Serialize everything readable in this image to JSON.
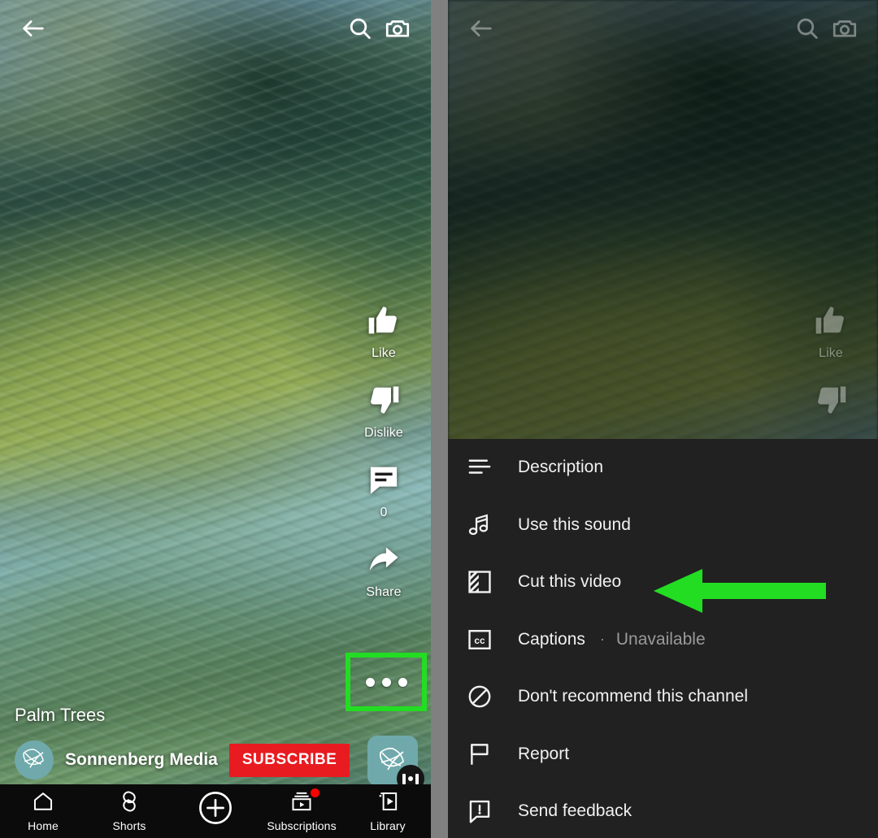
{
  "colors": {
    "accent_green": "#22dd22",
    "subscribe_red": "#e81b21",
    "sheet_bg": "#212121",
    "nav_bg": "#0b0b0b",
    "avatar_teal": "#6fa9ab",
    "divider_gray": "#808080"
  },
  "topbar": {
    "back_icon": "back-arrow-icon",
    "search_icon": "search-icon",
    "camera_icon": "camera-icon"
  },
  "shorts_player": {
    "video_title": "Palm Trees",
    "channel_name": "Sonnenberg Media",
    "subscribe_label": "SUBSCRIBE",
    "sound_disc_label": "sound-disc",
    "actions": [
      {
        "id": "like",
        "icon": "thumbs-up-icon",
        "label": "Like"
      },
      {
        "id": "dislike",
        "icon": "thumbs-down-icon",
        "label": "Dislike"
      },
      {
        "id": "comment",
        "icon": "comment-icon",
        "label": "0"
      },
      {
        "id": "share",
        "icon": "share-arrow-icon",
        "label": "Share"
      }
    ],
    "more_button": {
      "icon": "more-horizontal-icon",
      "highlighted": true,
      "highlight_color": "#22dd22"
    }
  },
  "bottom_nav": {
    "items": [
      {
        "id": "home",
        "icon": "home-icon",
        "label": "Home",
        "badge": false
      },
      {
        "id": "shorts",
        "icon": "shorts-icon",
        "label": "Shorts",
        "badge": false
      },
      {
        "id": "create",
        "icon": "plus-circle-icon",
        "label": "",
        "badge": false
      },
      {
        "id": "subscriptions",
        "icon": "subscriptions-icon",
        "label": "Subscriptions",
        "badge": true
      },
      {
        "id": "library",
        "icon": "library-icon",
        "label": "Library",
        "badge": false
      }
    ]
  },
  "options_sheet": {
    "items": [
      {
        "id": "description",
        "icon": "description-lines-icon",
        "label": "Description",
        "separator": "",
        "value": ""
      },
      {
        "id": "use-this-sound",
        "icon": "music-note-icon",
        "label": "Use this sound",
        "separator": "",
        "value": ""
      },
      {
        "id": "cut-this-video",
        "icon": "cut-video-icon",
        "label": "Cut this video",
        "separator": "",
        "value": ""
      },
      {
        "id": "captions",
        "icon": "closed-captions-icon",
        "label": "Captions",
        "separator": "·",
        "value": "Unavailable"
      },
      {
        "id": "dont-recommend",
        "icon": "block-circle-icon",
        "label": "Don't recommend this channel",
        "separator": "",
        "value": ""
      },
      {
        "id": "report",
        "icon": "flag-icon",
        "label": "Report",
        "separator": "",
        "value": ""
      },
      {
        "id": "send-feedback",
        "icon": "feedback-alert-icon",
        "label": "Send feedback",
        "separator": "",
        "value": ""
      }
    ]
  },
  "annotations": {
    "arrow": {
      "icon": "left-pointing-arrow-annotation",
      "color": "#22dd22",
      "points_to": "Cut this video"
    },
    "box": {
      "icon": "highlight-box-annotation",
      "color": "#22dd22",
      "surrounds": "more-horizontal-icon"
    }
  }
}
